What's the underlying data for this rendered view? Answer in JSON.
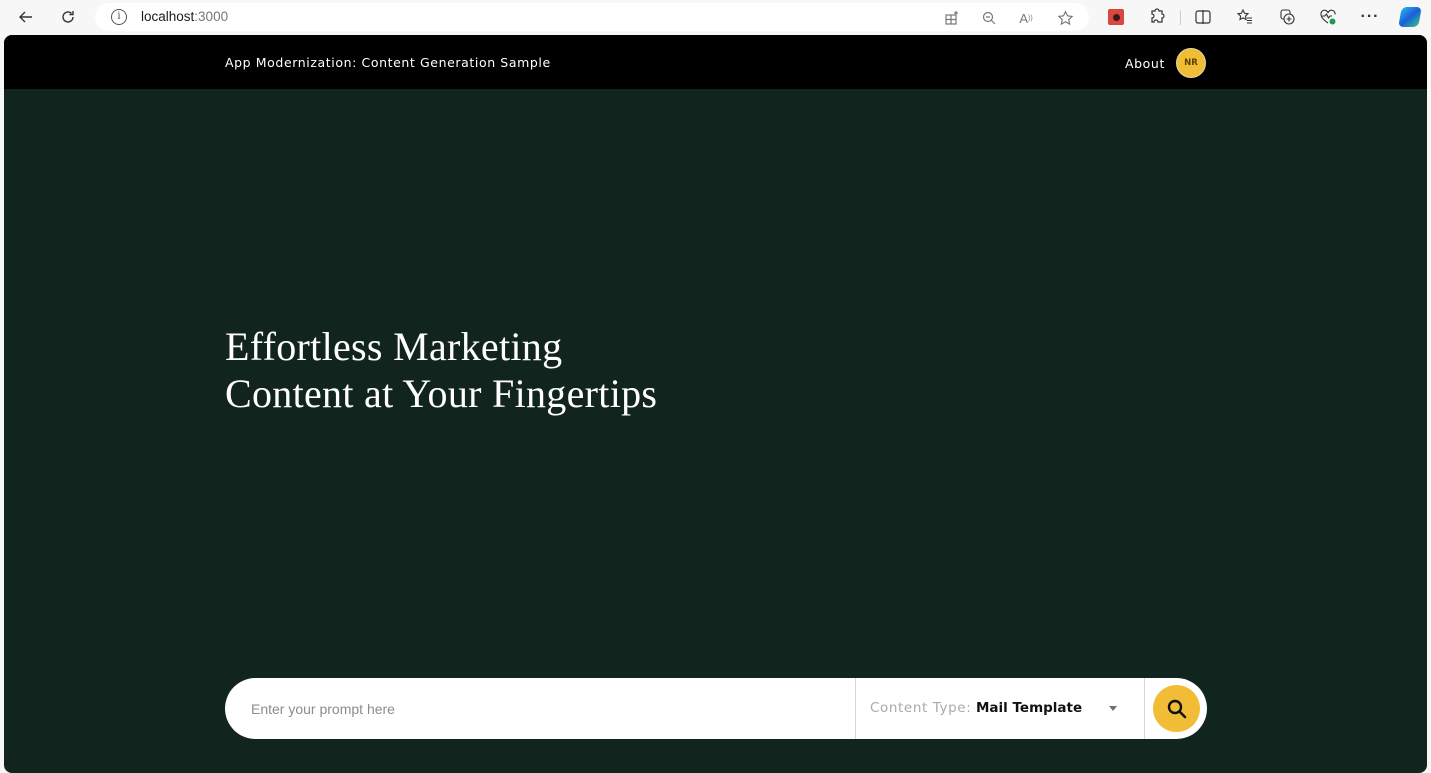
{
  "browser": {
    "url_host": "localhost",
    "url_port": ":3000",
    "toolbar_icons": [
      "back-icon",
      "refresh-icon",
      "info-icon",
      "app-available-icon",
      "zoom-out-icon",
      "read-aloud-icon",
      "favorite-star-icon",
      "extension-badge-icon",
      "extensions-icon",
      "split-screen-icon",
      "favorites-icon",
      "collections-icon",
      "browser-essentials-icon",
      "more-menu-icon",
      "copilot-icon"
    ]
  },
  "header": {
    "title": "App Modernization: Content Generation Sample",
    "about_label": "About",
    "avatar_initials": "NR"
  },
  "hero": {
    "line1": "Effortless Marketing",
    "line2": "Content at Your Fingertips"
  },
  "prompt": {
    "placeholder": "Enter your prompt here",
    "value": "",
    "content_type_label": "Content Type:",
    "content_type_value": "Mail Template"
  },
  "colors": {
    "page_bg": "#12241e",
    "header_bg": "#000000",
    "accent": "#f2bd36"
  }
}
